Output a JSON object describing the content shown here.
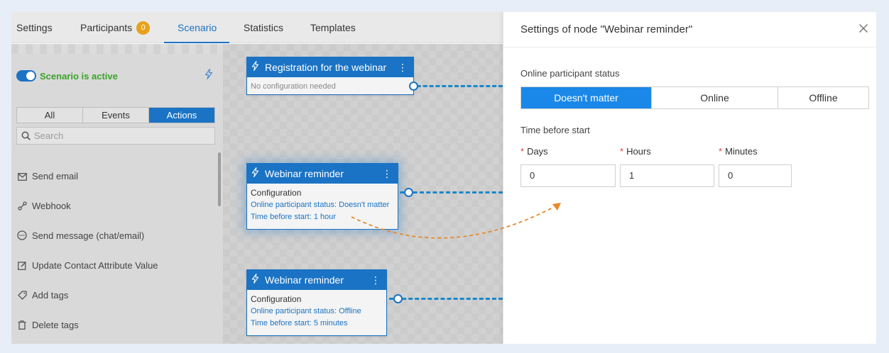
{
  "tabs": [
    {
      "label": "Settings"
    },
    {
      "label": "Participants",
      "badge": "0"
    },
    {
      "label": "Scenario"
    },
    {
      "label": "Statistics"
    },
    {
      "label": "Templates"
    }
  ],
  "scenario": {
    "status_label": "Scenario is active"
  },
  "filter": {
    "all": "All",
    "events": "Events",
    "actions": "Actions"
  },
  "search": {
    "placeholder": "Search"
  },
  "actions": [
    {
      "label": "Send email",
      "icon": "mail-icon"
    },
    {
      "label": "Webhook",
      "icon": "webhook-icon"
    },
    {
      "label": "Send message (chat/email)",
      "icon": "chat-icon"
    },
    {
      "label": "Update Contact Attribute Value",
      "icon": "edit-icon"
    },
    {
      "label": "Add tags",
      "icon": "tag-icon"
    },
    {
      "label": "Delete tags",
      "icon": "trash-icon"
    }
  ],
  "nodes": [
    {
      "title": "Registration for the webinar",
      "subtitle": "No configuration needed"
    },
    {
      "title": "Webinar reminder",
      "config": "Configuration",
      "status": "Online participant status: Doesn't matter",
      "time": "Time before start: 1 hour"
    },
    {
      "title": "Webinar reminder",
      "config": "Configuration",
      "status": "Online participant status: Offline",
      "time": "Time before start: 5 minutes"
    }
  ],
  "panel": {
    "title": "Settings of node \"Webinar reminder\"",
    "status_label": "Online participant status",
    "status_options": [
      "Doesn't matter",
      "Online",
      "Offline"
    ],
    "selected_status": "Doesn't matter",
    "time_label": "Time before start",
    "required_mark": "*",
    "days_label": "Days",
    "hours_label": "Hours",
    "minutes_label": "Minutes",
    "days_value": "0",
    "hours_value": "1",
    "minutes_value": "0"
  },
  "colors": {
    "accent": "#1a73c4",
    "active_green": "#3aa32a",
    "badge": "#e8a21a",
    "arrow": "#e8892a"
  }
}
